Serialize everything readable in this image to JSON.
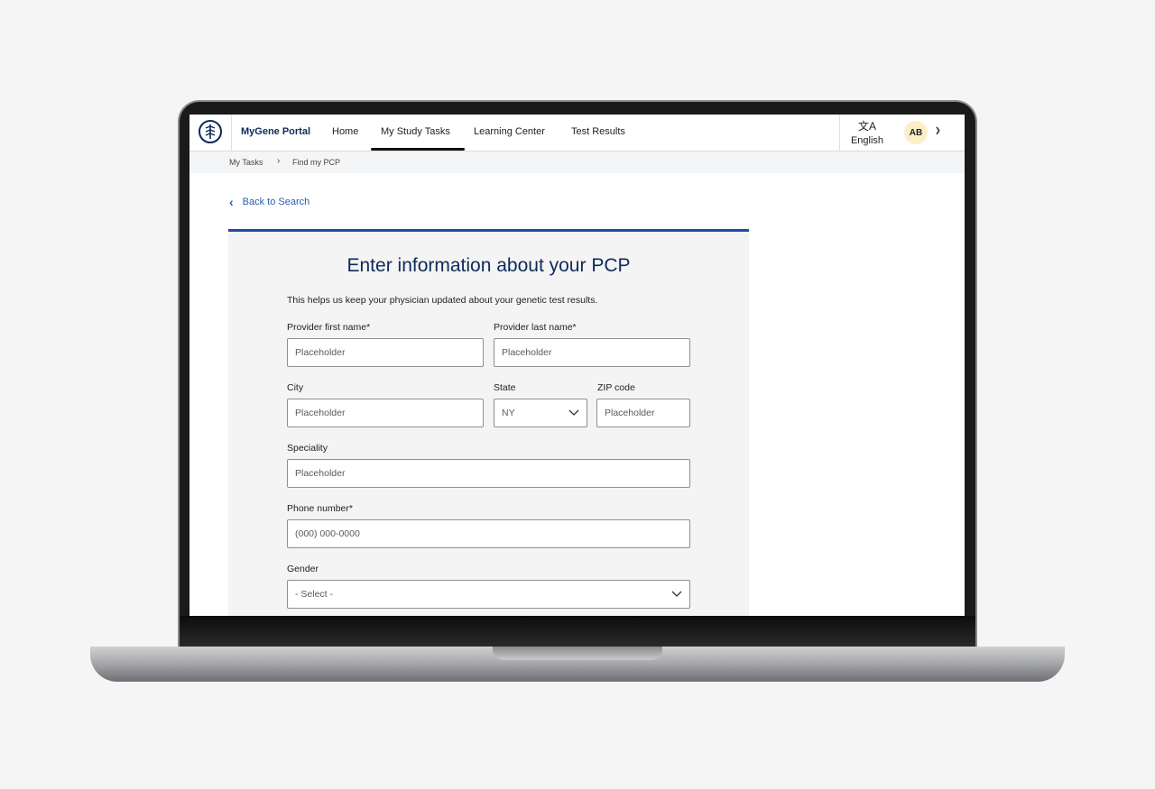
{
  "header": {
    "brand": "MyGene Portal",
    "nav": [
      {
        "label": "Home"
      },
      {
        "label": "My Study Tasks",
        "active": true
      },
      {
        "label": "Learning Center"
      },
      {
        "label": "Test Results"
      }
    ],
    "language_icon": "translate-icon",
    "language_label": "English",
    "avatar_initials": "AB"
  },
  "breadcrumb": [
    "My Tasks",
    "Find my PCP"
  ],
  "back_link": "Back to Search",
  "form": {
    "title": "Enter information about your PCP",
    "subtitle": "This helps us keep your physician updated about your genetic test results.",
    "first_name": {
      "label": "Provider first name*",
      "placeholder": "Placeholder"
    },
    "last_name": {
      "label": "Provider last name*",
      "placeholder": "Placeholder"
    },
    "city": {
      "label": "City",
      "placeholder": "Placeholder"
    },
    "state": {
      "label": "State",
      "value": "NY"
    },
    "zip": {
      "label": "ZIP code",
      "placeholder": "Placeholder"
    },
    "specialty": {
      "label": "Speciality",
      "placeholder": "Placeholder"
    },
    "phone": {
      "label": "Phone number*",
      "placeholder": "(000) 000-0000"
    },
    "gender": {
      "label": "Gender",
      "value": "- Select -"
    }
  },
  "colors": {
    "brand": "#0e2a5a",
    "accent": "#1f4aa5",
    "link": "#2a5db0",
    "avatar_bg": "#fbefc8"
  }
}
